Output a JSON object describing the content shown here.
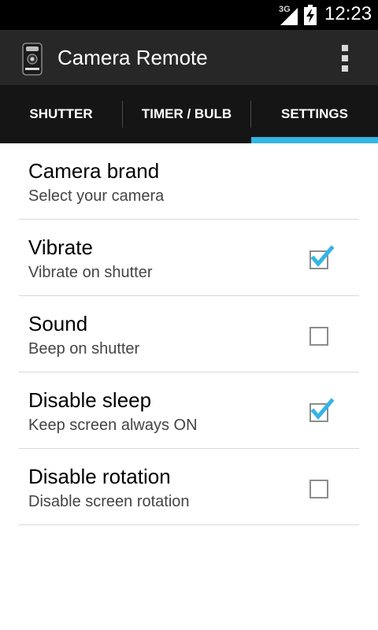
{
  "status_bar": {
    "network": "3G",
    "time": "12:23"
  },
  "action_bar": {
    "title": "Camera Remote",
    "app_icon": "camera-remote-icon",
    "overflow_icon": "overflow-menu-icon"
  },
  "tabs": [
    {
      "label": "SHUTTER",
      "selected": false
    },
    {
      "label": "TIMER / BULB",
      "selected": false
    },
    {
      "label": "SETTINGS",
      "selected": true
    }
  ],
  "settings": [
    {
      "title": "Camera brand",
      "summary": "Select your camera",
      "checkbox": null
    },
    {
      "title": "Vibrate",
      "summary": "Vibrate on shutter",
      "checkbox": true
    },
    {
      "title": "Sound",
      "summary": "Beep on shutter",
      "checkbox": false
    },
    {
      "title": "Disable sleep",
      "summary": "Keep screen always ON",
      "checkbox": true
    },
    {
      "title": "Disable rotation",
      "summary": "Disable screen rotation",
      "checkbox": false
    }
  ],
  "colors": {
    "accent": "#33b5e5",
    "status_bar": "#000000",
    "action_bar": "#272727",
    "tab_bar": "#151515",
    "check_mark": "#33b5e5"
  }
}
